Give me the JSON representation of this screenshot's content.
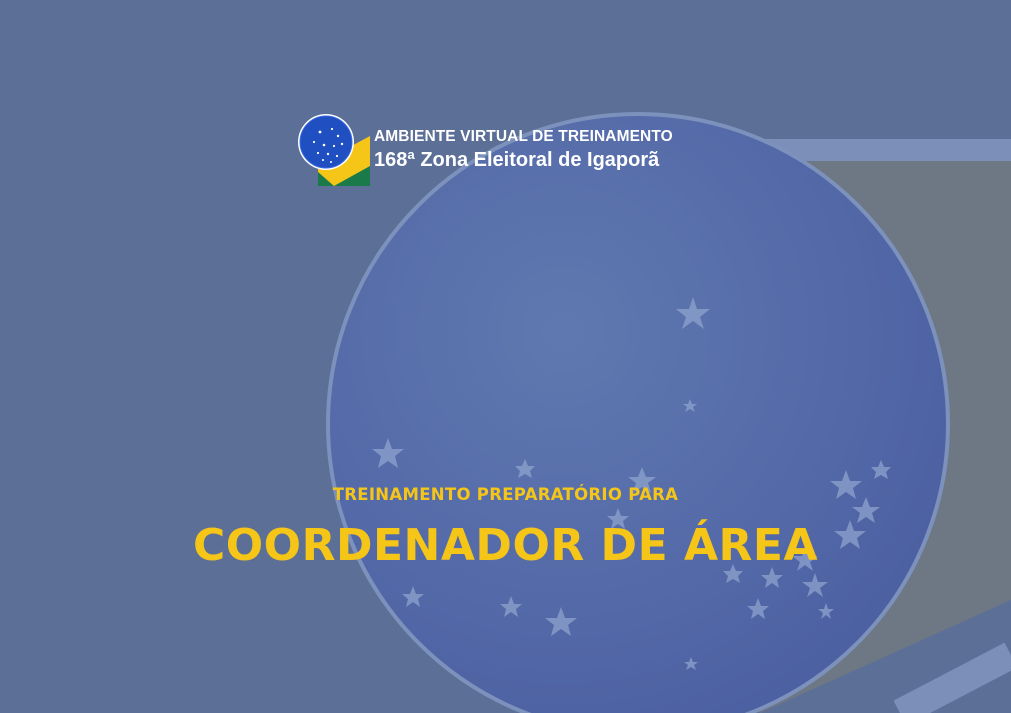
{
  "colors": {
    "background": "#5b6f97",
    "accent_yellow": "#f5c518",
    "globe_blue": "#5166a8",
    "slab_gray": "#6e7784",
    "logo_green": "#1a7a4a",
    "logo_yellow": "#f5c518",
    "text_white": "#ffffff"
  },
  "logo": {
    "icon": "electoral-justice-globe-icon",
    "line1": "AMBIENTE VIRTUAL DE TREINAMENTO",
    "line2": "168ª Zona Eleitoral de Igaporã"
  },
  "hero": {
    "subtitle": "TREINAMENTO PREPARATÓRIO PARA",
    "title": "COORDENADOR DE ÁREA"
  },
  "decor": {
    "background_icon": "starry-globe-icon"
  }
}
